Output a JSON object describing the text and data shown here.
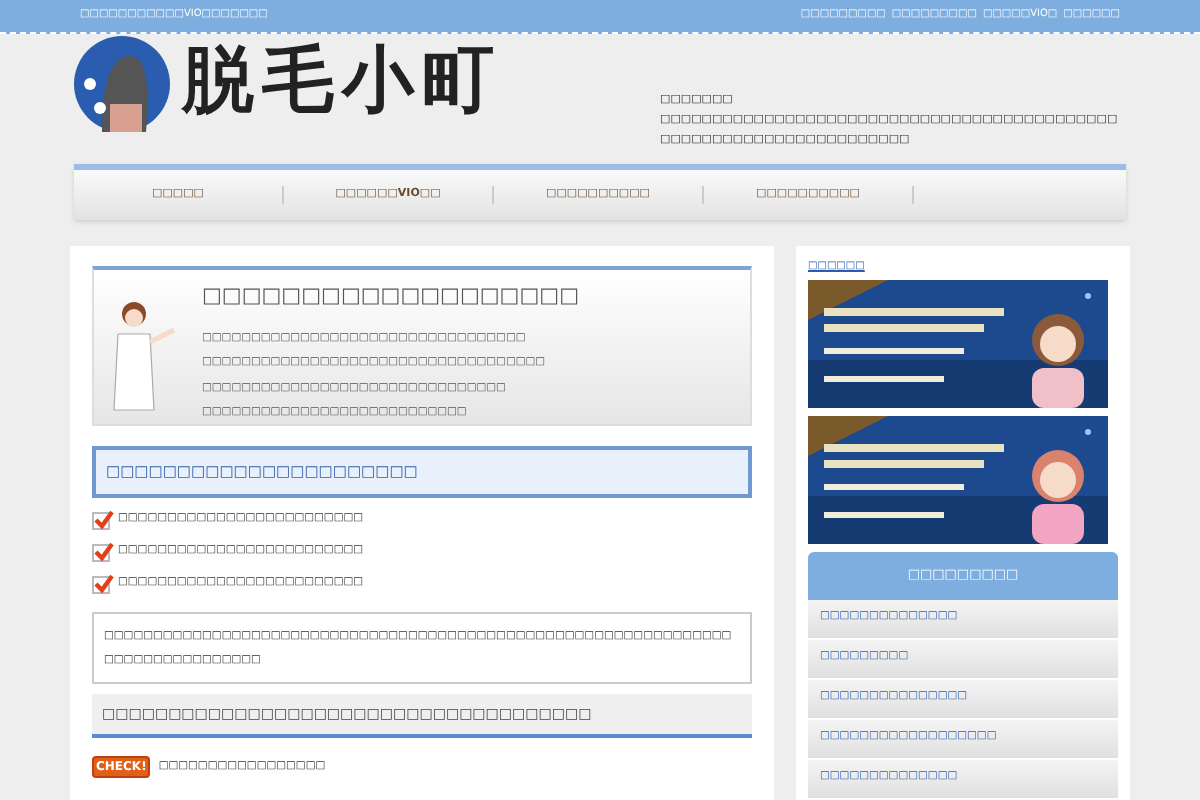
{
  "top_bar": {
    "left": "□□□□□□□□□□□VIO□□□□□□□",
    "right": [
      "□□□□□□□□□",
      "□□□□□□□□□",
      "□□□□□VIO□",
      "□□□□□□"
    ]
  },
  "logo": {
    "text": "脱毛小町"
  },
  "site_description": {
    "title": "□□□□□□□",
    "body": "□□□□□□□□□□□□□□□□□□□□□□□□□□□□□□□□□□□□□□□□□□□□□□□□□□□□□□□□□□□□□□□□□□□□"
  },
  "nav": [
    "□□□□□",
    "□□□□□□VIO□□",
    "□□□□□□□□□□",
    "□□□□□□□□□□"
  ],
  "intro": {
    "title": "□□□□□□□□□□□□□□□□□□□",
    "lines": [
      "□□□□□□□□□□□□□□□□□□□□□□□□□□□□□□□□□",
      "□□□□□□□□□□□□□□□□□□□□□□□□□□□□□□□□□□□",
      "□□□□□□□□□□□□□□□□□□□□□□□□□□□□□□□",
      "□□□□□□□□□□□□□□□□□□□□□□□□□□□"
    ]
  },
  "heading": "□□□□□□□□□□□□□□□□□□□□□□",
  "checklist": [
    {
      "text": "□□□□□□□□□□□□□□□□□□□□□□□□□",
      "checked": true
    },
    {
      "text": "□□□□□□□□□□□□□□□□□□□□□□□□□",
      "checked": true
    },
    {
      "text": "□□□□□□□□□□□□□□□□□□□□□□□□□",
      "checked": true
    }
  ],
  "note": "□□□□□□□□□□□□□□□□□□□□□□□□□□□□□□□□□□□□□□□□□□□□□□□□□□□□□□□□□□□□□□□□□□□□□□□□□□□□□□□□",
  "section_heading": "□□□□□□□□□□□□□□□□□□□□□□□□□□□□□□□□□□□□□",
  "check_item": {
    "badge": "CHECK!",
    "text": "□□□□□□□□□□□□□□□□□"
  },
  "sidebar": {
    "link": "□□□□□□",
    "menu": {
      "title": "□□□□□□□□□",
      "items": [
        "□□□□□□□□□□□□□□",
        "□□□□□□□□□",
        "□□□□□□□□□□□□□□□",
        "□□□□□□□□□□□□□□□□□□",
        "□□□□□□□□□□□□□□"
      ]
    }
  }
}
